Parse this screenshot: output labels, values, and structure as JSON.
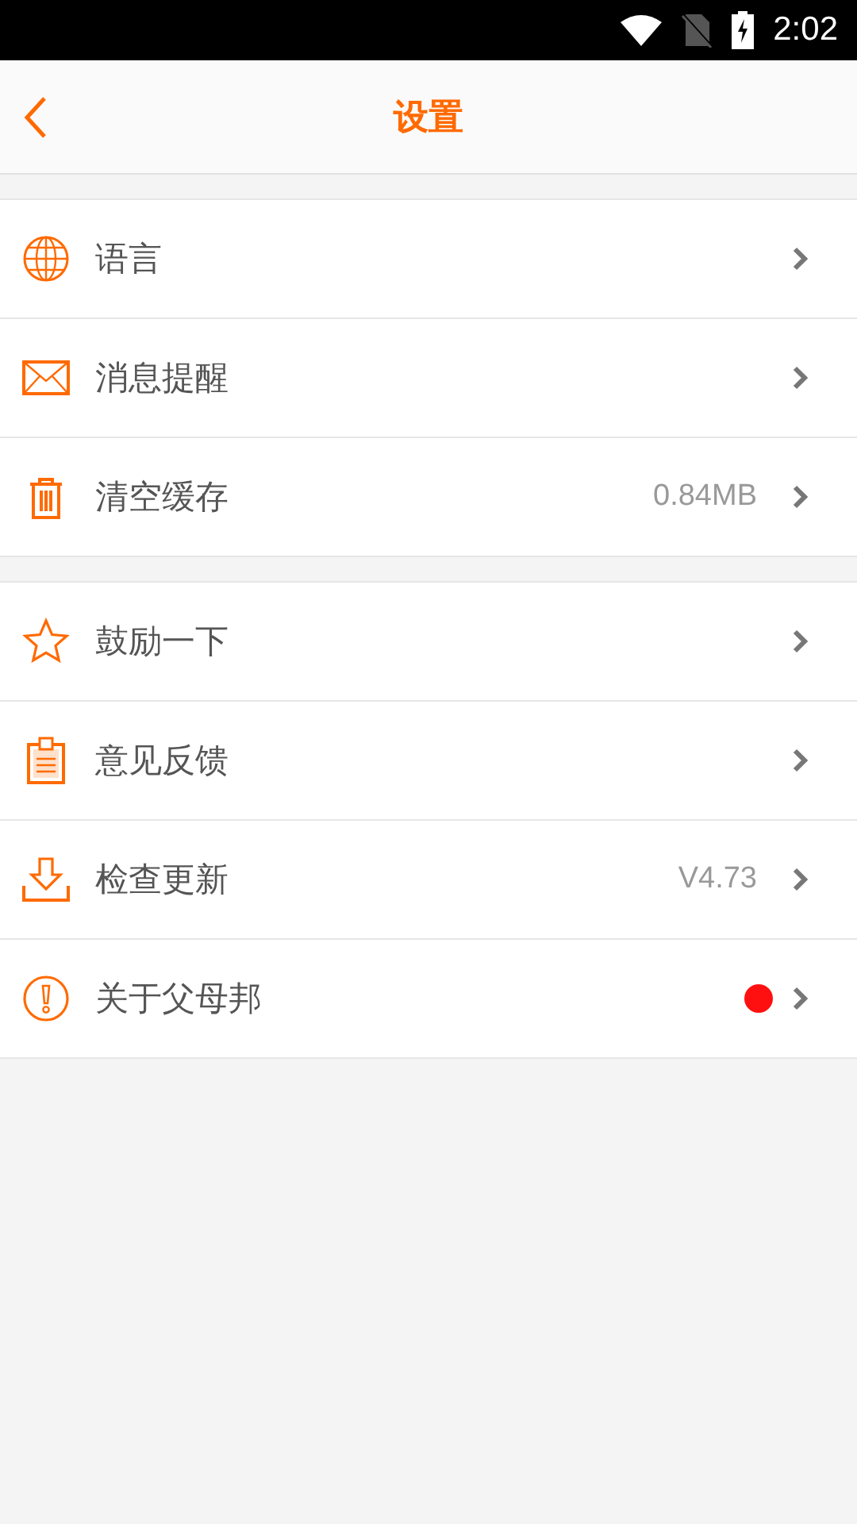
{
  "status_bar": {
    "time": "2:02"
  },
  "header": {
    "title": "设置"
  },
  "groups": [
    {
      "items": [
        {
          "kind": "globe",
          "label": "语言"
        },
        {
          "kind": "mail",
          "label": "消息提醒"
        },
        {
          "kind": "trash",
          "label": "清空缓存",
          "value": "0.84MB"
        }
      ]
    },
    {
      "items": [
        {
          "kind": "star",
          "label": "鼓励一下"
        },
        {
          "kind": "clipboard",
          "label": "意见反馈"
        },
        {
          "kind": "download",
          "label": "检查更新",
          "value": "V4.73"
        },
        {
          "kind": "alert",
          "label": "关于父母邦",
          "new_badge": true
        }
      ]
    }
  ]
}
